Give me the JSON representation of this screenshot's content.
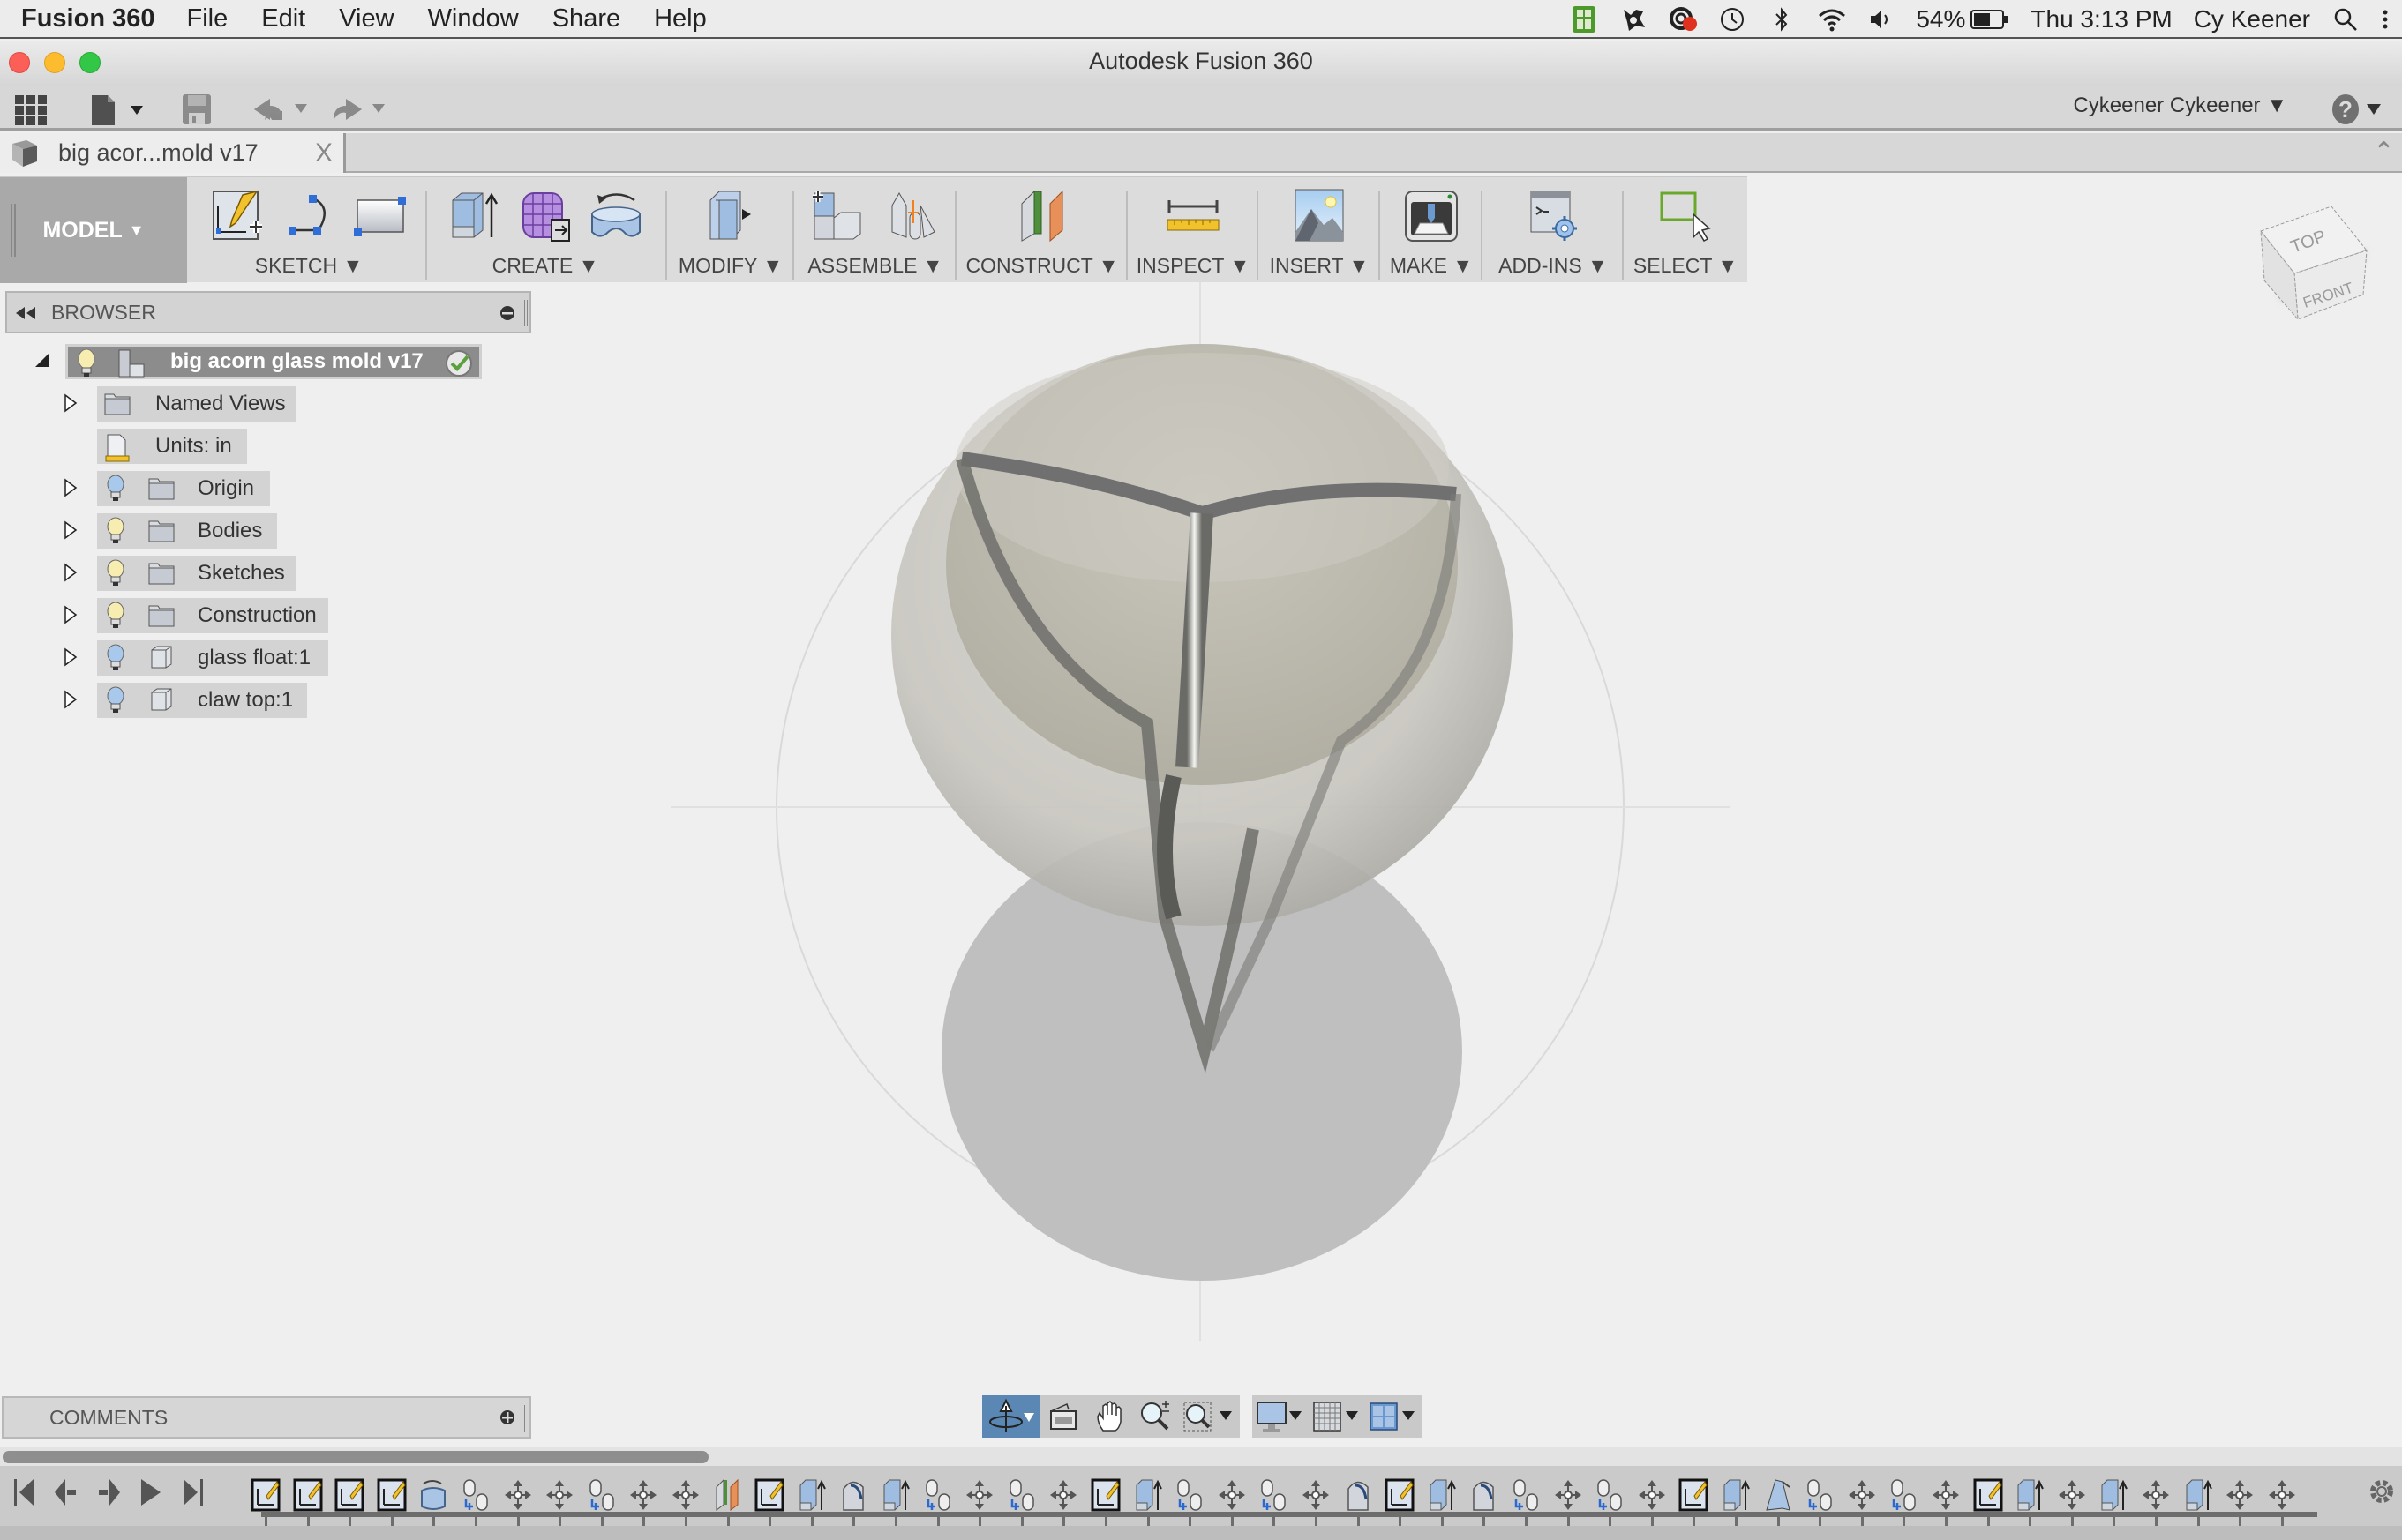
{
  "menubar": {
    "app_name": "Fusion 360",
    "items": [
      "File",
      "Edit",
      "View",
      "Window",
      "Share",
      "Help"
    ],
    "battery": "54%",
    "clock": "Thu 3:13 PM",
    "user": "Cy Keener",
    "tray_icons": [
      "evernote-icon",
      "avast-icon",
      "creative-cloud-icon",
      "time-machine-icon",
      "bluetooth-icon",
      "wifi-icon",
      "volume-icon",
      "battery-icon",
      "spotlight-search-icon",
      "notification-center-icon"
    ]
  },
  "window": {
    "title": "Autodesk Fusion 360"
  },
  "quick_access": {
    "user_account": "Cykeener Cykeener",
    "icons": [
      "data-panel-grid-icon",
      "file-menu-icon",
      "save-icon",
      "undo-icon",
      "redo-icon",
      "help-icon"
    ]
  },
  "document_tab": {
    "label": "big acor...mold v17",
    "close": "X"
  },
  "ribbon": {
    "workspace": "MODEL",
    "groups": [
      {
        "label": "SKETCH",
        "icons": [
          "create-sketch-icon",
          "arc-icon",
          "rectangle-icon"
        ]
      },
      {
        "label": "CREATE",
        "icons": [
          "extrude-icon",
          "create-form-icon",
          "revolve-icon"
        ]
      },
      {
        "label": "MODIFY",
        "icons": [
          "press-pull-icon"
        ]
      },
      {
        "label": "ASSEMBLE",
        "icons": [
          "new-component-icon",
          "joint-icon"
        ]
      },
      {
        "label": "CONSTRUCT",
        "icons": [
          "offset-plane-icon"
        ]
      },
      {
        "label": "INSPECT",
        "icons": [
          "measure-icon"
        ]
      },
      {
        "label": "INSERT",
        "icons": [
          "insert-canvas-icon"
        ]
      },
      {
        "label": "MAKE",
        "icons": [
          "3d-print-icon"
        ]
      },
      {
        "label": "ADD-INS",
        "icons": [
          "scripts-addins-icon"
        ]
      },
      {
        "label": "SELECT",
        "icons": [
          "select-icon"
        ]
      }
    ]
  },
  "browser": {
    "title": "BROWSER",
    "root": {
      "label": "big acorn glass mold v17",
      "visible": true,
      "active": true
    },
    "items": [
      {
        "label": "Named Views",
        "expandable": true,
        "bulb": "none",
        "icon": "folder"
      },
      {
        "label": "Units: in",
        "expandable": false,
        "bulb": "none",
        "icon": "units-doc"
      },
      {
        "label": "Origin",
        "expandable": true,
        "bulb": "hidden",
        "icon": "folder"
      },
      {
        "label": "Bodies",
        "expandable": true,
        "bulb": "visible",
        "icon": "folder"
      },
      {
        "label": "Sketches",
        "expandable": true,
        "bulb": "visible",
        "icon": "folder"
      },
      {
        "label": "Construction",
        "expandable": true,
        "bulb": "visible",
        "icon": "folder"
      },
      {
        "label": "glass float:1",
        "expandable": true,
        "bulb": "hidden",
        "icon": "component"
      },
      {
        "label": "claw top:1",
        "expandable": true,
        "bulb": "hidden",
        "icon": "component"
      }
    ]
  },
  "viewcube": {
    "top": "TOP",
    "front": "FRONT"
  },
  "comments": {
    "title": "COMMENTS"
  },
  "navbar": {
    "tools": [
      "orbit-icon",
      "look-at-icon",
      "pan-icon",
      "zoom-icon",
      "fit-icon",
      "display-settings-icon",
      "grid-icon",
      "viewports-icon"
    ],
    "active_tool": "orbit-icon"
  },
  "timeline": {
    "controls": [
      "go-to-start",
      "step-back",
      "play",
      "step-forward",
      "go-to-end"
    ],
    "features": [
      "sketch",
      "sketch",
      "sketch",
      "sketch",
      "revolve",
      "joint",
      "move",
      "move",
      "joint",
      "move",
      "move",
      "plane",
      "sketch",
      "extrude",
      "loft",
      "extrude",
      "joint",
      "move",
      "joint",
      "move",
      "sketch",
      "extrude",
      "joint",
      "move",
      "joint",
      "move",
      "loft",
      "sketch",
      "extrude",
      "loft",
      "joint",
      "move",
      "joint",
      "move",
      "sketch",
      "extrude",
      "sweep",
      "joint",
      "move",
      "joint",
      "move",
      "sketch",
      "extrude",
      "move",
      "extrude",
      "move",
      "extrude",
      "move",
      "move"
    ],
    "scroll_position": 0.29
  },
  "colors": {
    "accent_nav": "#5a87b3",
    "workspace_button": "#a9a9a9",
    "visible_bulb": "#f8edb0",
    "hidden_bulb": "#a8c8ec",
    "check_green": "#5aa03c",
    "select_green": "#6aa82c"
  }
}
